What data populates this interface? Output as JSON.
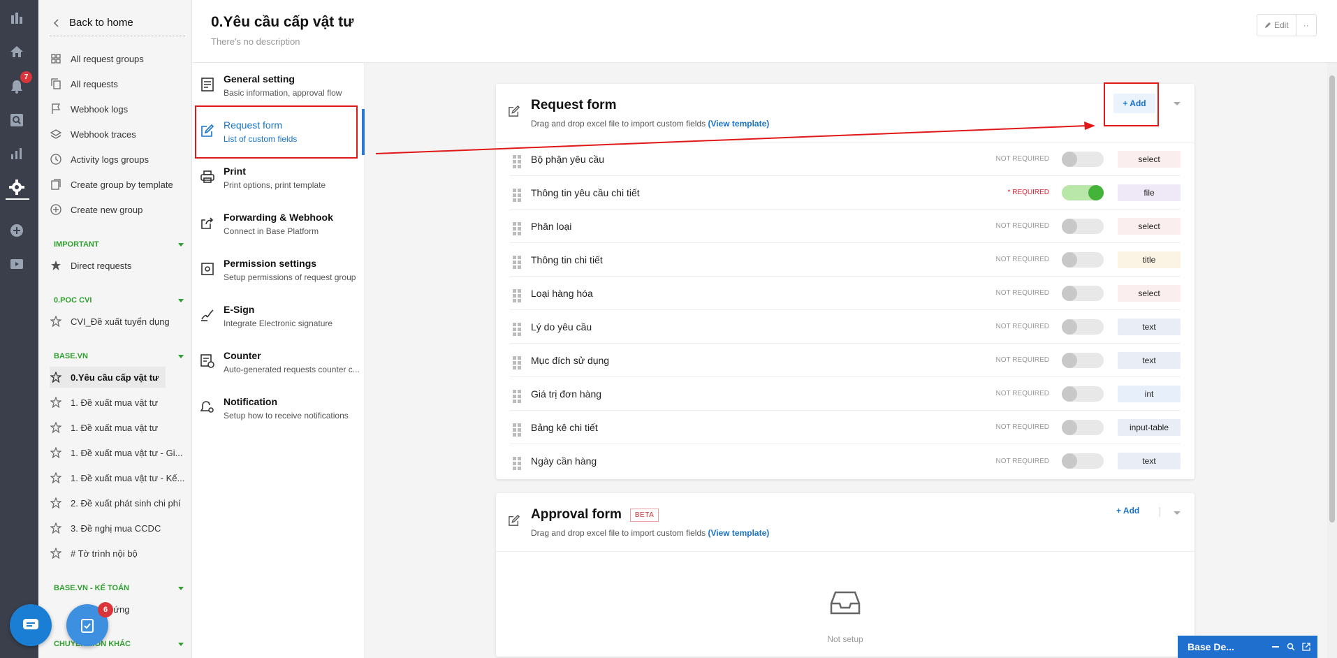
{
  "sidebar": {
    "back_label": "Back to home",
    "nav": [
      {
        "label": "All request groups",
        "icon": "grid-icon"
      },
      {
        "label": "All requests",
        "icon": "copy-icon"
      },
      {
        "label": "Webhook logs",
        "icon": "flag-icon"
      },
      {
        "label": "Webhook traces",
        "icon": "layers-icon"
      },
      {
        "label": "Activity logs groups",
        "icon": "clock-icon"
      },
      {
        "label": "Create group by template",
        "icon": "template-icon"
      },
      {
        "label": "Create new group",
        "icon": "plus-circle-icon"
      }
    ],
    "sections": [
      {
        "title": "IMPORTANT",
        "items": [
          "Direct requests"
        ]
      },
      {
        "title": "0.POC CVI",
        "items": [
          "CVI_Đề xuất tuyển dụng"
        ]
      },
      {
        "title": "BASE.VN",
        "items": [
          "0.Yêu cầu cấp vật tư",
          "1. Đề xuất mua vật tư",
          "1. Đề xuất mua vật tư",
          "1. Đề xuất mua vật tư - Gi...",
          "1. Đề xuất mua vật tư - Kế...",
          "2. Đề xuất phát sinh chi phí",
          "3. Đề nghị mua CCDC",
          "# Tờ trình nội bộ"
        ]
      },
      {
        "title": "BASE.VN - KẾ TOÁN",
        "items": [
          "tạm ứng"
        ]
      },
      {
        "title": "CHUYÊN MÔN KHÁC",
        "items": []
      }
    ]
  },
  "rail": {
    "notification_count": "7"
  },
  "fab": {
    "tasks_count": "6"
  },
  "header": {
    "title": "0.Yêu cầu cấp vật tư",
    "description": "There's no description",
    "edit_label": "Edit",
    "more_label": "··"
  },
  "menu": [
    {
      "title": "General setting",
      "subtitle": "Basic information, approval flow",
      "icon": "document-icon"
    },
    {
      "title": "Request form",
      "subtitle": "List of custom fields",
      "icon": "edit-icon"
    },
    {
      "title": "Print",
      "subtitle": "Print options, print template",
      "icon": "printer-icon"
    },
    {
      "title": "Forwarding & Webhook",
      "subtitle": "Connect in Base Platform",
      "icon": "share-icon"
    },
    {
      "title": "Permission settings",
      "subtitle": "Setup permissions of request group",
      "icon": "gear-box-icon"
    },
    {
      "title": "E-Sign",
      "subtitle": "Integrate Electronic signature",
      "icon": "signature-icon"
    },
    {
      "title": "Counter",
      "subtitle": "Auto-generated requests counter c...",
      "icon": "counter-icon"
    },
    {
      "title": "Notification",
      "subtitle": "Setup how to receive notifications",
      "icon": "bell-gear-icon"
    }
  ],
  "request_form": {
    "title": "Request form",
    "subtitle": "Drag and drop excel file to import custom fields",
    "template_link": "(View template)",
    "add_label": "+ Add",
    "fields": [
      {
        "name": "Bộ phận yêu cầu",
        "required": "NOT REQUIRED",
        "on": false,
        "type": "select",
        "color": "#fbeeee"
      },
      {
        "name": "Thông tin yêu cầu chi tiết",
        "required": "* REQUIRED",
        "on": true,
        "type": "file",
        "color": "#efe9f7"
      },
      {
        "name": "Phân loại",
        "required": "NOT REQUIRED",
        "on": false,
        "type": "select",
        "color": "#fbeeee"
      },
      {
        "name": "Thông tin chi tiết",
        "required": "NOT REQUIRED",
        "on": false,
        "type": "title",
        "color": "#fbf3e3"
      },
      {
        "name": "Loại hàng hóa",
        "required": "NOT REQUIRED",
        "on": false,
        "type": "select",
        "color": "#fbeeee"
      },
      {
        "name": "Lý do yêu cầu",
        "required": "NOT REQUIRED",
        "on": false,
        "type": "text",
        "color": "#e9eef6"
      },
      {
        "name": "Mục đích sử dụng",
        "required": "NOT REQUIRED",
        "on": false,
        "type": "text",
        "color": "#e9eef6"
      },
      {
        "name": "Giá trị đơn hàng",
        "required": "NOT REQUIRED",
        "on": false,
        "type": "int",
        "color": "#e7f0fa"
      },
      {
        "name": "Bảng kê chi tiết",
        "required": "NOT REQUIRED",
        "on": false,
        "type": "input-table",
        "color": "#e9eef6"
      },
      {
        "name": "Ngày cần hàng",
        "required": "NOT REQUIRED",
        "on": false,
        "type": "text",
        "color": "#e9eef6"
      }
    ]
  },
  "approval_form": {
    "title": "Approval form",
    "badge": "BETA",
    "subtitle": "Drag and drop excel file to import custom fields",
    "template_link": "(View template)",
    "add_label": "+ Add",
    "empty_text": "Not setup"
  },
  "chat_widget": {
    "label": "Base De..."
  }
}
